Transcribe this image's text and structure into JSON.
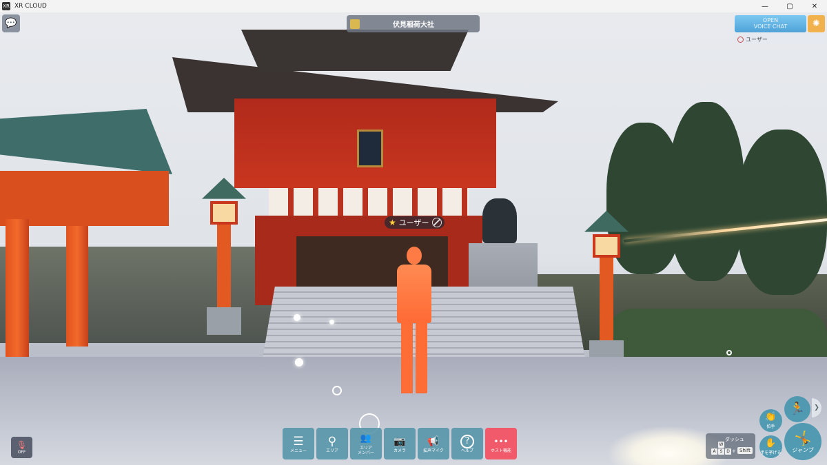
{
  "window": {
    "title": "XR CLOUD",
    "app_icon": "XR",
    "controls": {
      "minimize": "—",
      "maximize": "▢",
      "close": "✕"
    }
  },
  "hud": {
    "location_name": "伏見稲荷大社",
    "voice_chat": {
      "line1": "OPEN",
      "line2": "VOICE CHAT"
    },
    "user_filter_label": "ユーザー",
    "mic": {
      "label": "OFF",
      "state": "off"
    },
    "user_tag": {
      "name": "ユーザー"
    }
  },
  "toolbar": {
    "items": [
      {
        "label": "メニュー",
        "icon": "menu-icon",
        "glyph": "☰"
      },
      {
        "label": "エリア",
        "icon": "map-pin-icon",
        "glyph": "⚲"
      },
      {
        "label": "エリア\nメンバー",
        "icon": "members-icon",
        "glyph": "👥"
      },
      {
        "label": "カメラ",
        "icon": "camera-icon",
        "glyph": "📷"
      },
      {
        "label": "拡声マイク",
        "icon": "megaphone-icon",
        "glyph": "📢"
      },
      {
        "label": "ヘルプ",
        "icon": "help-icon",
        "glyph": "?"
      },
      {
        "label": "ホスト機能",
        "icon": "more-icon",
        "glyph": "•••"
      }
    ]
  },
  "controls_hint": {
    "dash_label": "ダッシュ",
    "keys": [
      "W",
      "A",
      "S",
      "D"
    ],
    "plus": "+",
    "shift": "Shift"
  },
  "actions": {
    "clap": "拍手",
    "raise_hand": "手を挙げる",
    "jump": "ジャンプ"
  },
  "colors": {
    "toolbar_button": "#5896aa",
    "host_button": "#f05a6a",
    "voice_chat": "#4fa2d8",
    "avatar": "#ff7b45"
  }
}
